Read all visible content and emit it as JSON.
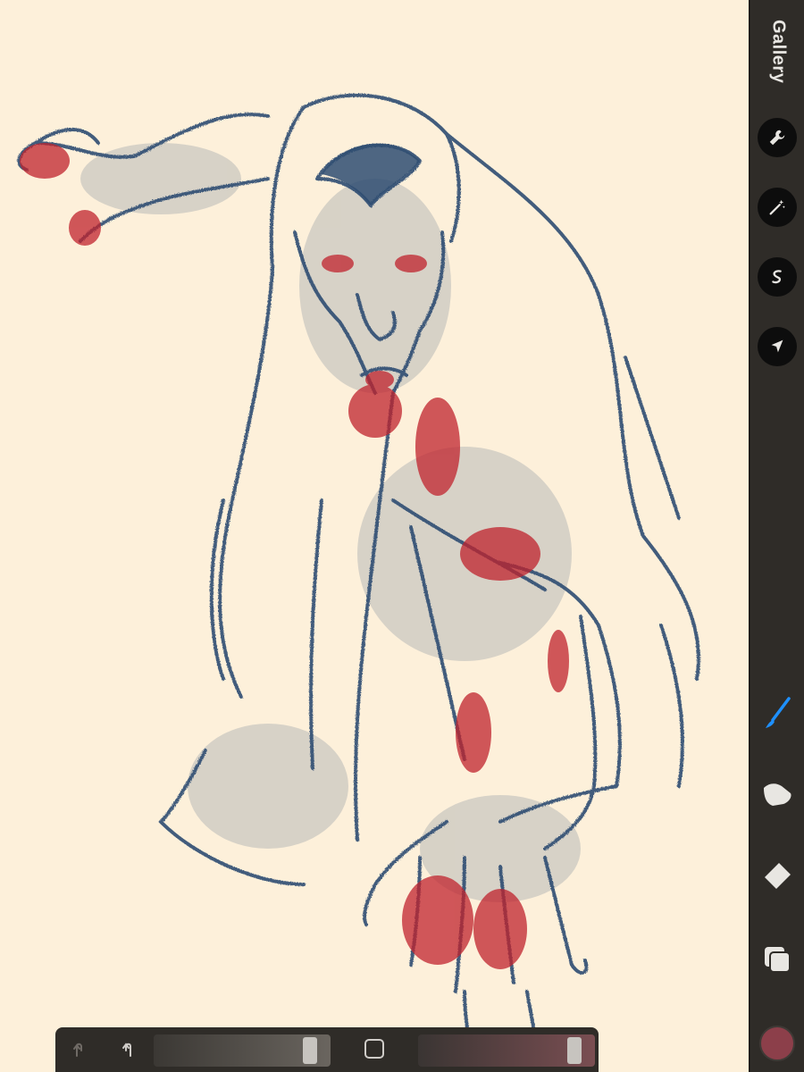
{
  "app": {
    "gallery_label": "Gallery"
  },
  "toolbar": {
    "items": [
      {
        "name": "actions",
        "icon": "wrench-icon"
      },
      {
        "name": "adjustments",
        "icon": "magic-wand-icon"
      },
      {
        "name": "selection",
        "icon": "selection-s-icon"
      },
      {
        "name": "transform",
        "icon": "arrow-cursor-icon"
      },
      {
        "name": "brush",
        "icon": "brush-icon",
        "active": true
      },
      {
        "name": "smudge",
        "icon": "smudge-finger-icon"
      },
      {
        "name": "eraser",
        "icon": "eraser-icon"
      },
      {
        "name": "layers",
        "icon": "layers-icon"
      }
    ],
    "current_color": "#8c3f4a",
    "accent_color": "#1e90ff"
  },
  "bottom_bar": {
    "undo_icon": "undo-icon",
    "redo_icon": "redo-icon",
    "modify_icon": "square-icon",
    "brush_size_level": 0.92,
    "opacity_level": 0.92
  },
  "canvas": {
    "background": "#fdf0da",
    "ink_color": "#2f4d72",
    "accent_ink": "#c0232d"
  }
}
